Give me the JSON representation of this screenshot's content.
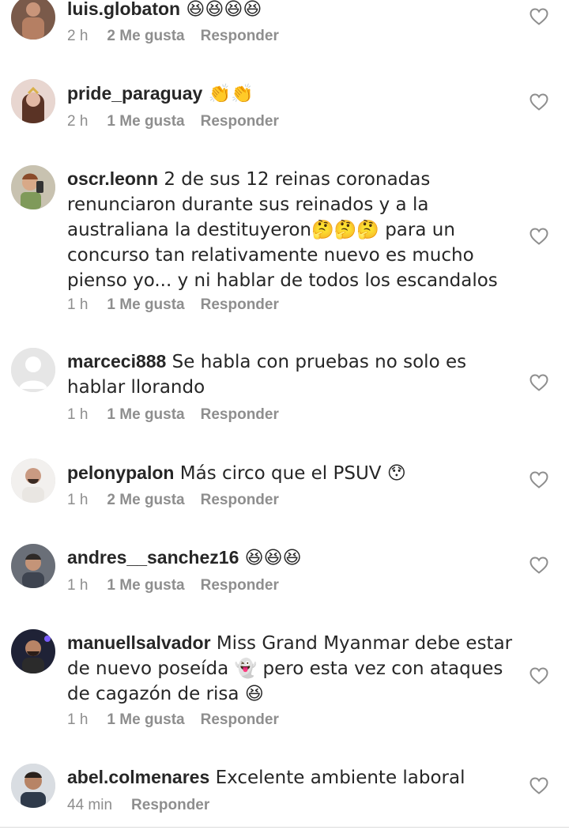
{
  "comments": [
    {
      "username": "luis.globaton",
      "text": " 😆😆😆😆",
      "time": "2 h",
      "likes": "2 Me gusta",
      "reply": "Responder"
    },
    {
      "username": "pride_paraguay",
      "text": " 👏👏",
      "time": "2 h",
      "likes": "1 Me gusta",
      "reply": "Responder"
    },
    {
      "username": "oscr.leonn",
      "text": " 2 de sus 12 reinas coronadas renunciaron durante sus reinados y a la australiana la destituyeron🤔🤔🤔 para un concurso tan relativamente nuevo es mucho pienso yo... y ni hablar de todos los escandalos",
      "time": "1 h",
      "likes": "1 Me gusta",
      "reply": "Responder"
    },
    {
      "username": "marceci888",
      "text": " Se habla con pruebas no solo es hablar llorando",
      "time": "1 h",
      "likes": "1 Me gusta",
      "reply": "Responder"
    },
    {
      "username": "pelonypalon",
      "text": " Más circo que el PSUV 😯",
      "time": "1 h",
      "likes": "2 Me gusta",
      "reply": "Responder"
    },
    {
      "username": "andres__sanchez16",
      "text": " 😆😆😆",
      "time": "1 h",
      "likes": "1 Me gusta",
      "reply": "Responder"
    },
    {
      "username": "manuellsalvador",
      "text": " Miss Grand Myanmar debe estar de nuevo poseída 👻 pero esta vez con ataques de cagazón de risa 😆",
      "time": "1 h",
      "likes": "1 Me gusta",
      "reply": "Responder"
    },
    {
      "username": "abel.colmenares",
      "text": " Excelente ambiente laboral",
      "time": "44 min",
      "likes": "",
      "reply": "Responder"
    }
  ]
}
